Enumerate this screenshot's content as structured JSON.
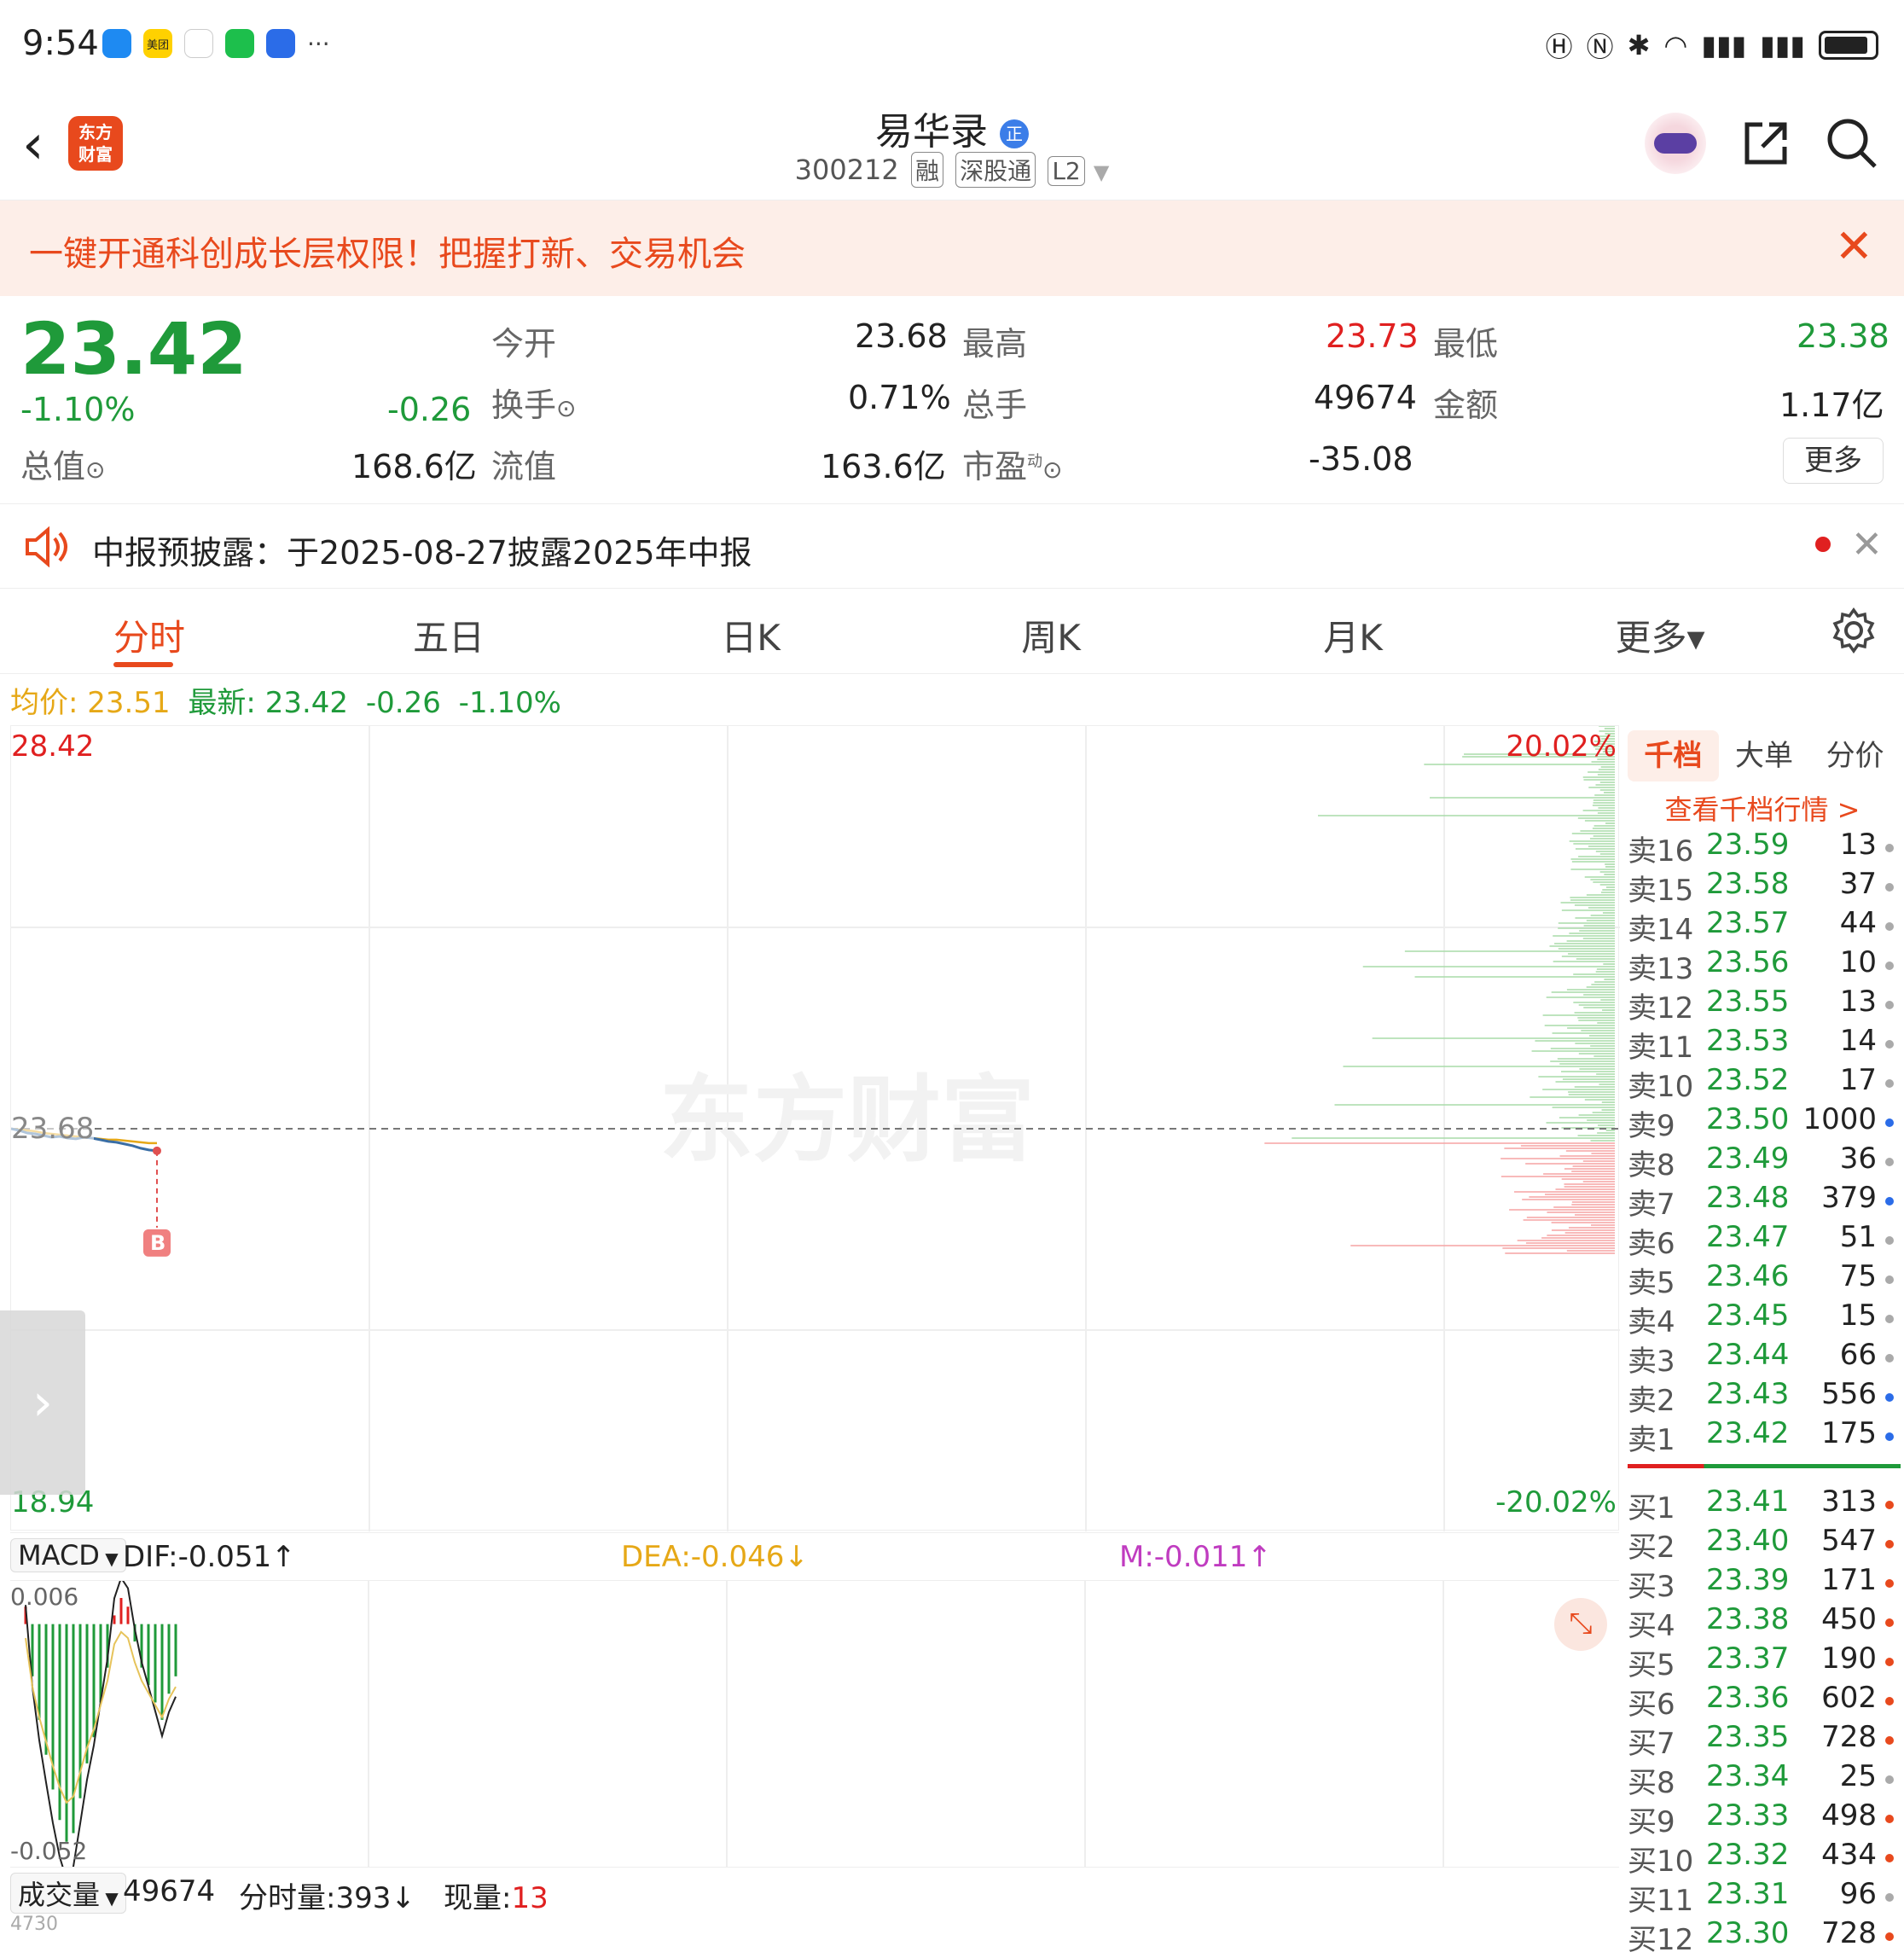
{
  "status_bar": {
    "time": "9:54",
    "apps": [
      {
        "icon": "message-icon",
        "label": "",
        "color": "#1e8af2"
      },
      {
        "icon": "meituan-icon",
        "label": "美团",
        "color": "#ffd100"
      },
      {
        "icon": "flower-app-icon",
        "label": "",
        "color": "#ffffff"
      },
      {
        "icon": "wechat-icon",
        "label": "",
        "color": "#1dbf4c"
      },
      {
        "icon": "location-app-icon",
        "label": "",
        "color": "#2b6ce8"
      }
    ],
    "more_apps": "···"
  },
  "header": {
    "back_symbol": "‹",
    "logo_text": "东方\n财富",
    "stock_name": "易华录",
    "badge": "正",
    "stock_code": "300212",
    "tags": [
      "融",
      "深股通",
      "L2"
    ]
  },
  "banner": {
    "text": "一键开通科创成长层权限！把握打新、交易机会",
    "close": "✕"
  },
  "quote": {
    "price": "23.42",
    "change_pct": "-1.10%",
    "change": "-0.26",
    "open_label": "今开",
    "open": "23.68",
    "high_label": "最高",
    "high": "23.73",
    "low_label": "最低",
    "low": "23.38",
    "turnover_label": "换手",
    "turnover": "0.71%",
    "volume_label": "总手",
    "volume": "49674",
    "amount_label": "金额",
    "amount": "1.17亿",
    "mktcap_label": "总值",
    "mktcap": "168.6亿",
    "float_label": "流值",
    "float": "163.6亿",
    "pe_label": "市盈",
    "pe_sup": "动",
    "pe": "-35.08",
    "more": "更多"
  },
  "notice": {
    "text": "中报预披露：于2025-08-27披露2025年中报",
    "close": "✕"
  },
  "tabs": [
    {
      "label": "分时",
      "active": true
    },
    {
      "label": "五日"
    },
    {
      "label": "日K"
    },
    {
      "label": "周K"
    },
    {
      "label": "月K"
    },
    {
      "label": "更多▾"
    }
  ],
  "avg_line": {
    "avg_label": "均价:",
    "avg": "23.51",
    "latest_label": "最新:",
    "latest": "23.42",
    "chg": "-0.26",
    "pct": "-1.10%"
  },
  "chart_data": {
    "type": "line",
    "title": "",
    "y_top": "28.42",
    "y_bottom": "18.94",
    "pct_top": "20.02%",
    "pct_bottom": "-20.02%",
    "prev_close": "23.68",
    "ylim": [
      18.94,
      28.42
    ],
    "marker": "B",
    "watermark": "东方财富",
    "price_series": [
      23.68,
      23.66,
      23.63,
      23.62,
      23.6,
      23.58,
      23.59,
      23.57,
      23.56,
      23.58,
      23.57,
      23.55,
      23.53,
      23.52,
      23.5,
      23.48,
      23.45,
      23.43,
      23.42
    ],
    "avg_series": [
      23.68,
      23.67,
      23.66,
      23.65,
      23.63,
      23.62,
      23.61,
      23.6,
      23.59,
      23.58,
      23.57,
      23.56,
      23.55,
      23.55,
      23.54,
      23.53,
      23.52,
      23.51,
      23.51
    ]
  },
  "macd": {
    "name": "MACD",
    "dif": "DIF:-0.051↑",
    "dea": "DEA:-0.046↓",
    "m": "M:-0.011↑",
    "top": "0.006",
    "bottom": "-0.052",
    "bars": [
      0.004,
      -0.012,
      -0.022,
      -0.03,
      -0.038,
      -0.045,
      -0.05,
      -0.048,
      -0.04,
      -0.032,
      -0.026,
      -0.018,
      -0.01,
      0.002,
      0.006,
      0.004,
      -0.004,
      -0.01,
      -0.014,
      -0.018,
      -0.022,
      -0.016,
      -0.012
    ]
  },
  "volume": {
    "name": "成交量",
    "total": "49674",
    "per_min_label": "分时量:",
    "per_min": "393↓",
    "now_label": "现量:",
    "now": "13",
    "partial_label": "4730"
  },
  "orderbook": {
    "tabs": [
      "千档",
      "大单",
      "分价"
    ],
    "link": "查看千档行情 >",
    "asks": [
      {
        "label": "卖16",
        "price": "23.59",
        "vol": "13",
        "dot": "#aaaaaa"
      },
      {
        "label": "卖15",
        "price": "23.58",
        "vol": "37",
        "dot": "#aaaaaa"
      },
      {
        "label": "卖14",
        "price": "23.57",
        "vol": "44",
        "dot": "#aaaaaa"
      },
      {
        "label": "卖13",
        "price": "23.56",
        "vol": "10",
        "dot": "#aaaaaa"
      },
      {
        "label": "卖12",
        "price": "23.55",
        "vol": "13",
        "dot": "#aaaaaa"
      },
      {
        "label": "卖11",
        "price": "23.53",
        "vol": "14",
        "dot": "#aaaaaa"
      },
      {
        "label": "卖10",
        "price": "23.52",
        "vol": "17",
        "dot": "#aaaaaa"
      },
      {
        "label": "卖9",
        "price": "23.50",
        "vol": "1000",
        "dot": "#2b6ce8"
      },
      {
        "label": "卖8",
        "price": "23.49",
        "vol": "36",
        "dot": "#aaaaaa"
      },
      {
        "label": "卖7",
        "price": "23.48",
        "vol": "379",
        "dot": "#2b6ce8"
      },
      {
        "label": "卖6",
        "price": "23.47",
        "vol": "51",
        "dot": "#aaaaaa"
      },
      {
        "label": "卖5",
        "price": "23.46",
        "vol": "75",
        "dot": "#aaaaaa"
      },
      {
        "label": "卖4",
        "price": "23.45",
        "vol": "15",
        "dot": "#aaaaaa"
      },
      {
        "label": "卖3",
        "price": "23.44",
        "vol": "66",
        "dot": "#aaaaaa"
      },
      {
        "label": "卖2",
        "price": "23.43",
        "vol": "556",
        "dot": "#2b6ce8"
      },
      {
        "label": "卖1",
        "price": "23.42",
        "vol": "175",
        "dot": "#2b6ce8"
      }
    ],
    "bids": [
      {
        "label": "买1",
        "price": "23.41",
        "vol": "313",
        "dot": "#e8491d"
      },
      {
        "label": "买2",
        "price": "23.40",
        "vol": "547",
        "dot": "#e8491d"
      },
      {
        "label": "买3",
        "price": "23.39",
        "vol": "171",
        "dot": "#e8491d"
      },
      {
        "label": "买4",
        "price": "23.38",
        "vol": "450",
        "dot": "#e8491d"
      },
      {
        "label": "买5",
        "price": "23.37",
        "vol": "190",
        "dot": "#e8491d"
      },
      {
        "label": "买6",
        "price": "23.36",
        "vol": "602",
        "dot": "#e8491d"
      },
      {
        "label": "买7",
        "price": "23.35",
        "vol": "728",
        "dot": "#e8491d"
      },
      {
        "label": "买8",
        "price": "23.34",
        "vol": "25",
        "dot": "#aaaaaa"
      },
      {
        "label": "买9",
        "price": "23.33",
        "vol": "498",
        "dot": "#e8491d"
      },
      {
        "label": "买10",
        "price": "23.32",
        "vol": "434",
        "dot": "#e8491d"
      },
      {
        "label": "买11",
        "price": "23.31",
        "vol": "96",
        "dot": "#aaaaaa"
      },
      {
        "label": "买12",
        "price": "23.30",
        "vol": "728",
        "dot": "#e8491d"
      }
    ]
  },
  "colors": {
    "up": "#e02020",
    "down": "#1f9a3a",
    "accent": "#e8491d",
    "avg": "#e6a817",
    "price_line": "#3a6ea5"
  }
}
